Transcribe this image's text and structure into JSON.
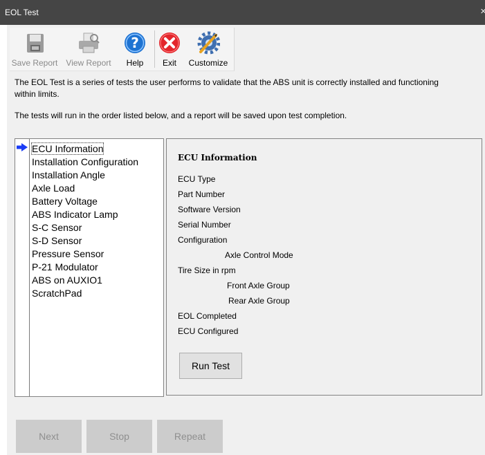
{
  "window": {
    "title": "EOL Test",
    "close_glyph": "×"
  },
  "toolbar": {
    "buttons": [
      {
        "label": "Save Report",
        "icon": "floppy-icon",
        "enabled": false
      },
      {
        "label": "View Report",
        "icon": "printer-icon",
        "enabled": false
      },
      {
        "label": "Help",
        "icon": "help-icon",
        "enabled": true
      },
      {
        "label": "Exit",
        "icon": "exit-icon",
        "enabled": true
      },
      {
        "label": "Customize",
        "icon": "customize-icon",
        "enabled": true
      }
    ]
  },
  "description": {
    "line1": "The EOL Test is a series of tests the user performs to validate that the ABS unit is correctly installed and functioning",
    "line2": "within limits.",
    "line3": "The tests will run in the order listed below, and a report will be saved upon test completion."
  },
  "tests": {
    "selected_index": 0,
    "items": [
      "ECU Information",
      "Installation Configuration",
      "Installation Angle",
      "Axle Load",
      "Battery Voltage",
      "ABS Indicator Lamp",
      "S-C Sensor",
      "S-D Sensor",
      "Pressure Sensor",
      "P-21 Modulator",
      "ABS on AUXIO1",
      "ScratchPad"
    ]
  },
  "detail": {
    "heading": "ECU Information",
    "ecu_type": "ECU Type",
    "part_number": "Part Number",
    "software_version": "Software Version",
    "serial_number": "Serial Number",
    "configuration": "Configuration",
    "axle_control_mode": "Axle Control Mode",
    "tire_size": "Tire Size in rpm",
    "front_axle_group": "Front Axle Group",
    "rear_axle_group": "Rear Axle Group",
    "eol_completed": "EOL Completed",
    "ecu_configured": "ECU Configured",
    "run_test_label": "Run Test"
  },
  "footer": {
    "next_label": "Next",
    "stop_label": "Stop",
    "repeat_label": "Repeat"
  },
  "colors": {
    "titlebar": "#454545",
    "arrow": "#1a3cf5",
    "disabled_button": "#cccccc"
  }
}
